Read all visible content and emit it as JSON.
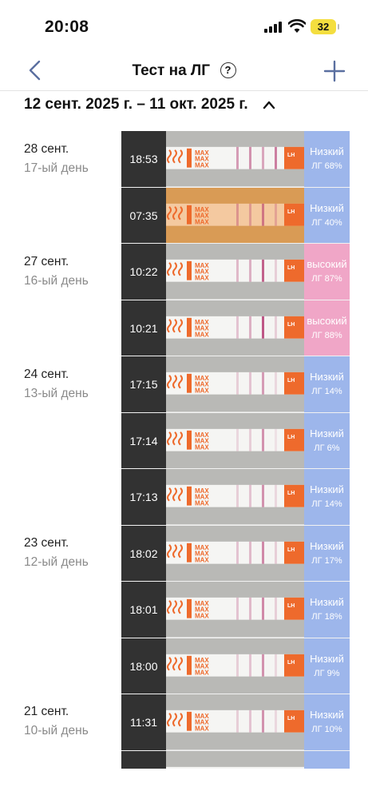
{
  "status": {
    "time": "20:08",
    "battery": "32"
  },
  "nav": {
    "title": "Тест на ЛГ",
    "help_glyph": "?"
  },
  "date_range": {
    "label": "12 сент. 2025 г. – 11 окт. 2025 г."
  },
  "colors": {
    "low": "#9db6eb",
    "high": "#f0a6c7",
    "time_bg": "#323232",
    "strip_orange": "#ee6a2c"
  },
  "days": [
    {
      "date": "28 сент.",
      "day": "17-ый день"
    },
    {
      "date": "27 сент.",
      "day": "16-ый день"
    },
    {
      "date": "24 сент.",
      "day": "13-ый день"
    },
    {
      "date": "23 сент.",
      "day": "12-ый день"
    },
    {
      "date": "21 сент.",
      "day": "10-ый день"
    }
  ],
  "tests": [
    {
      "time": "18:53",
      "level": "Низкий",
      "value": "ЛГ 68%",
      "status": "low",
      "strip_label": "MAX",
      "lines": [
        0.45,
        0.5,
        0.4,
        0.6
      ]
    },
    {
      "time": "07:35",
      "level": "Низкий",
      "value": "ЛГ 40%",
      "status": "low",
      "strip_label": "MAX",
      "lines": [
        0.35,
        0.3,
        0.55,
        0.25
      ]
    },
    {
      "time": "10:22",
      "level": "высокий",
      "value": "ЛГ 87%",
      "status": "high",
      "strip_label": "MAX",
      "lines": [
        0.3,
        0.35,
        0.75,
        0.2
      ]
    },
    {
      "time": "10:21",
      "level": "высокий",
      "value": "ЛГ 88%",
      "status": "high",
      "strip_label": "MAX",
      "lines": [
        0.25,
        0.35,
        0.8,
        0.2
      ]
    },
    {
      "time": "17:15",
      "level": "Низкий",
      "value": "ЛГ 14%",
      "status": "low",
      "strip_label": "MAX",
      "lines": [
        0.2,
        0.25,
        0.45,
        0.15
      ]
    },
    {
      "time": "17:14",
      "level": "Низкий",
      "value": "ЛГ 6%",
      "status": "low",
      "strip_label": "MAX",
      "lines": [
        0.15,
        0.2,
        0.5,
        0.1
      ]
    },
    {
      "time": "17:13",
      "level": "Низкий",
      "value": "ЛГ 14%",
      "status": "low",
      "strip_label": "MAX",
      "lines": [
        0.2,
        0.25,
        0.5,
        0.15
      ]
    },
    {
      "time": "18:02",
      "level": "Низкий",
      "value": "ЛГ 17%",
      "status": "low",
      "strip_label": "MAX",
      "lines": [
        0.25,
        0.3,
        0.55,
        0.2
      ]
    },
    {
      "time": "18:01",
      "level": "Низкий",
      "value": "ЛГ 18%",
      "status": "low",
      "strip_label": "MAX",
      "lines": [
        0.25,
        0.3,
        0.55,
        0.2
      ]
    },
    {
      "time": "18:00",
      "level": "Низкий",
      "value": "ЛГ 9%",
      "status": "low",
      "strip_label": "MAX",
      "lines": [
        0.2,
        0.25,
        0.5,
        0.15
      ]
    },
    {
      "time": "11:31",
      "level": "Низкий",
      "value": "ЛГ 10%",
      "status": "low",
      "strip_label": "MAX",
      "lines": [
        0.2,
        0.25,
        0.5,
        0.15
      ]
    },
    {
      "time": "",
      "level": "",
      "value": "",
      "status": "low",
      "strip_label": "",
      "lines": []
    }
  ]
}
